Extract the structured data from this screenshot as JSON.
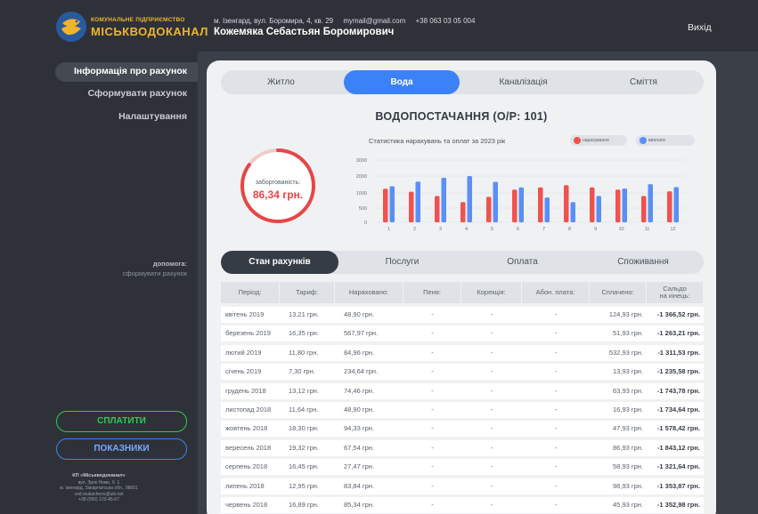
{
  "brand": {
    "top": "КОМУНАЛЬНЕ ПІДПРИЄМСТВО",
    "name": "МІСЬКВОДОКАНАЛ"
  },
  "header": {
    "address": "м. Ізенгард, вул. Боромира, 4, кв. 29",
    "email": "mymail@gmail.com",
    "phone": "+38 063 03 05 004",
    "user": "Кожемяка Себастьян Боромирович",
    "logout": "Вихід"
  },
  "sidebar": {
    "items": [
      {
        "label": "Інформація про рахунок"
      },
      {
        "label": "Сформувати рахунок"
      },
      {
        "label": "Налаштування"
      }
    ],
    "help_label": "допомога:",
    "help_link": "сформувати рахунок",
    "pay_button": "СПЛАТИТИ",
    "meter_button": "ПОКАЗНИКИ",
    "footer": {
      "org": "КП «Міськводоканал»",
      "line1": "вул. Зрок Номе, б. 1",
      "line2": "м. Ізенгард, Закарпатська обл., 98001",
      "line3": "vod.mukachevo@ukr.net",
      "line4": "+38 (050) 123-45-67"
    }
  },
  "tabs": [
    {
      "label": "Житло"
    },
    {
      "label": "Вода"
    },
    {
      "label": "Каналізація"
    },
    {
      "label": "Сміття"
    }
  ],
  "section_title": "ВОДОПОСТАЧАННЯ (О/Р: 101)",
  "debt": {
    "label": "заборгованість:",
    "value": "86,34 грн.",
    "ring_fraction": 0.85
  },
  "colors": {
    "accruals": "#f0524d",
    "payments": "#5b8ff7",
    "accent": "#3b82f6",
    "pay": "#34c759"
  },
  "chart_data": {
    "type": "bar",
    "title": "Статистика нарахувань та оплат за 2023 рік",
    "categories": [
      "1",
      "2",
      "3",
      "4",
      "5",
      "6",
      "7",
      "8",
      "9",
      "10",
      "11",
      "12"
    ],
    "series": [
      {
        "name": "нарахування",
        "values": [
          1250,
          1070,
          900,
          700,
          870,
          1200,
          1330,
          1460,
          1330,
          1200,
          900,
          1100
        ]
      },
      {
        "name": "виплати",
        "values": [
          1400,
          1670,
          1900,
          2000,
          1660,
          1330,
          850,
          700,
          900,
          1260,
          1520,
          1350
        ]
      }
    ],
    "yticks": [
      "0",
      "500",
      "1000",
      "2000",
      "3000"
    ],
    "ylim": [
      0,
      3000
    ]
  },
  "subtabs": [
    {
      "label": "Стан рахунків"
    },
    {
      "label": "Послуги"
    },
    {
      "label": "Оплата"
    },
    {
      "label": "Споживання"
    }
  ],
  "table": {
    "headers": [
      "Період:",
      "Тариф:",
      "Нараховано:",
      "Пеня:",
      "Корекція:",
      "Абон. плата:",
      "Сплачено:",
      "Сальдо\nна кінець:"
    ],
    "rows": [
      [
        "квітень 2019",
        "13,21 грн.",
        "48,90 грн.",
        "-",
        "-",
        "-",
        "124,93 грн.",
        "-1 366,52 грн."
      ],
      [
        "березень 2019",
        "16,35 грн.",
        "567,97 грн.",
        "-",
        "-",
        "-",
        "51,93 грн.",
        "-1 263,21 грн."
      ],
      [
        "лютий 2019",
        "11,80 грн.",
        "84,96 грн.",
        "-",
        "-",
        "-",
        "532,93 грн.",
        "-1 311,53 грн."
      ],
      [
        "січень 2019",
        "7,30 грн.",
        "234,64 грн.",
        "-",
        "-",
        "-",
        "13,93 грн.",
        "-1 235,58 грн."
      ],
      [
        "грудень 2018",
        "13,12 грн.",
        "74,46 грн.",
        "-",
        "-",
        "-",
        "63,93 грн.",
        "-1 743,78 грн."
      ],
      [
        "листопад 2018",
        "11,64 грн.",
        "48,90 грн.",
        "-",
        "-",
        "-",
        "16,93 грн.",
        "-1 734,64 грн."
      ],
      [
        "жовтень 2018",
        "18,30 грн.",
        "94,33 грн.",
        "-",
        "-",
        "-",
        "47,93 грн.",
        "-1 578,42 грн."
      ],
      [
        "вересень 2018",
        "19,32 грн.",
        "67,54 грн.",
        "-",
        "-",
        "-",
        "86,93 грн.",
        "-1 843,12 грн."
      ],
      [
        "серпень 2018",
        "16,45 грн.",
        "27,47 грн.",
        "-",
        "-",
        "-",
        "58,93 грн.",
        "-1 321,64 грн."
      ],
      [
        "липень 2018",
        "12,95 грн.",
        "83,84 грн.",
        "-",
        "-",
        "-",
        "98,93 грн.",
        "-1 353,87 грн."
      ],
      [
        "червень 2018",
        "16,89 грн.",
        "85,34 грн.",
        "-",
        "-",
        "-",
        "45,93 грн.",
        "-1 352,98 грн."
      ]
    ]
  }
}
